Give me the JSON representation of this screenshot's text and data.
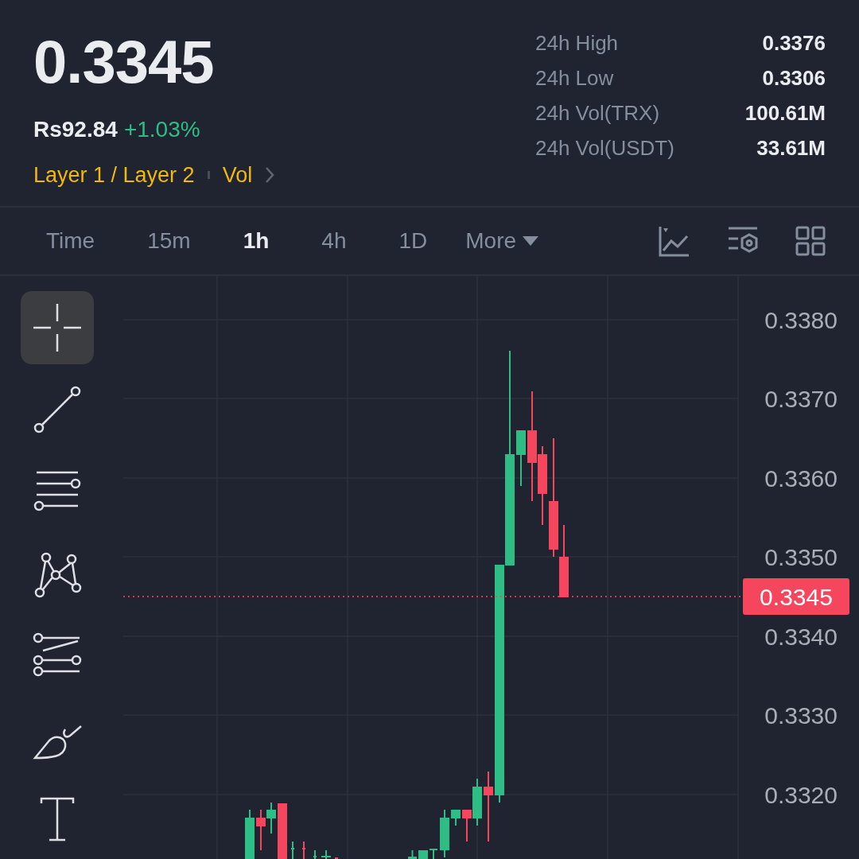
{
  "ticker": {
    "last_price": "0.3345",
    "fiat_price": "Rs92.84",
    "change": "+1.03%",
    "tags": [
      "Layer 1 / Layer 2",
      "Vol"
    ]
  },
  "stats": [
    {
      "label": "24h High",
      "value": "0.3376"
    },
    {
      "label": "24h Low",
      "value": "0.3306"
    },
    {
      "label": "24h Vol(TRX)",
      "value": "100.61M"
    },
    {
      "label": "24h Vol(USDT)",
      "value": "33.61M"
    }
  ],
  "intervals": [
    {
      "label": "Time",
      "selected": false
    },
    {
      "label": "15m",
      "selected": false
    },
    {
      "label": "1h",
      "selected": true
    },
    {
      "label": "4h",
      "selected": false
    },
    {
      "label": "1D",
      "selected": false
    }
  ],
  "more_menu": {
    "label": "More"
  },
  "drawing_tools": [
    {
      "kind": "crosshair",
      "selected": true
    },
    {
      "kind": "trendline",
      "selected": false
    },
    {
      "kind": "hlines",
      "selected": false
    },
    {
      "kind": "pattern",
      "selected": false
    },
    {
      "kind": "channel",
      "selected": false
    },
    {
      "kind": "brush",
      "selected": false
    },
    {
      "kind": "text",
      "selected": false
    }
  ],
  "price_axis": [
    "0.3380",
    "0.3370",
    "0.3360",
    "0.3350",
    "0.3340",
    "0.3330",
    "0.3320"
  ],
  "last_price_tag": "0.3345"
}
